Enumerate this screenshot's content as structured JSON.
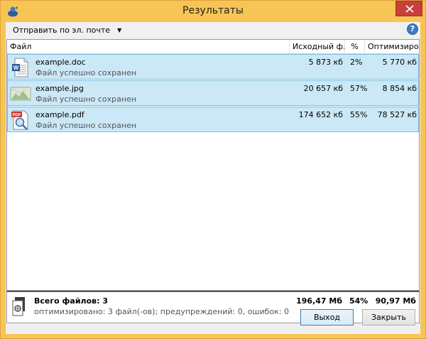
{
  "window": {
    "title": "Результаты"
  },
  "toolbar": {
    "email_label": "Отправить по эл. почте",
    "email_arrow": "▼",
    "help": "?"
  },
  "columns": {
    "file": "Файл",
    "original": "Исходный ф...",
    "percent": "%",
    "optimized": "Оптимизиро..."
  },
  "rows": [
    {
      "name": "example.doc",
      "status": "Файл успешно сохранен",
      "original": "5 873 кб",
      "percent": "2%",
      "optimized": "5 770 кб",
      "icon": "word-document-icon"
    },
    {
      "name": "example.jpg",
      "status": "Файл успешно сохранен",
      "original": "20 657 кб",
      "percent": "57%",
      "optimized": "8 854 кб",
      "icon": "image-file-icon"
    },
    {
      "name": "example.pdf",
      "status": "Файл успешно сохранен",
      "original": "174 652 кб",
      "percent": "55%",
      "optimized": "78 527 кб",
      "icon": "pdf-file-icon"
    }
  ],
  "icon_labels": {
    "word": "W",
    "pdf": "PDF"
  },
  "summary": {
    "title": "Всего файлов: 3",
    "subtitle": "оптимизировано: 3 файл(-ов); предупреждений: 0, ошибок: 0",
    "original": "196,47 Мб",
    "percent": "54%",
    "optimized": "90,97 Мб"
  },
  "buttons": {
    "exit": "Выход",
    "close": "Закрыть"
  },
  "colors": {
    "accent": "#f6c555",
    "selection": "#cbe8f6",
    "selection_border": "#7cc0e3",
    "close": "#c7403a"
  }
}
